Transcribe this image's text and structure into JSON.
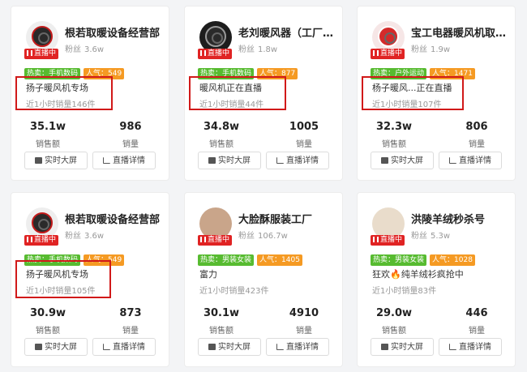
{
  "cards": [
    {
      "name": "根若取暖设备经营部",
      "fans_label": "粉丝",
      "fans": "3.6w",
      "live": "直播中",
      "hot": "热卖：手机数码",
      "pop": "人气：549",
      "line1": "扬子暖风机专场",
      "line2": "近1小时销量146件",
      "sales_amount": "35.1w",
      "sales_amount_label": "销售额",
      "sales": "986",
      "sales_label": "销量",
      "btn1": "实时大屏",
      "btn2": "直播详情"
    },
    {
      "name": "老刘暖风器（工厂直...",
      "fans_label": "粉丝",
      "fans": "1.8w",
      "live": "直播中",
      "hot": "热卖：手机数码",
      "pop": "人气：877",
      "line1": "暖风机正在直播",
      "line2": "近1小时销量44件",
      "sales_amount": "34.8w",
      "sales_amount_label": "销售额",
      "sales": "1005",
      "sales_label": "销量",
      "btn1": "实时大屏",
      "btn2": "直播详情"
    },
    {
      "name": "宝工电器暖风机取暖...",
      "fans_label": "粉丝",
      "fans": "1.9w",
      "live": "直播中",
      "hot": "热卖：户外运动",
      "pop": "人气：1471",
      "line1": "杨子暖风...正在直播",
      "line2": "近1小时销量107件",
      "sales_amount": "32.3w",
      "sales_amount_label": "销售额",
      "sales": "806",
      "sales_label": "销量",
      "btn1": "实时大屏",
      "btn2": "直播详情"
    },
    {
      "name": "根若取暖设备经营部",
      "fans_label": "粉丝",
      "fans": "3.6w",
      "live": "直播中",
      "hot": "热卖：手机数码",
      "pop": "人气：549",
      "line1": "扬子暖风机专场",
      "line2": "近1小时销量105件",
      "sales_amount": "30.9w",
      "sales_amount_label": "销售额",
      "sales": "873",
      "sales_label": "销量",
      "btn1": "实时大屏",
      "btn2": "直播详情"
    },
    {
      "name": "大脸酥服装工厂",
      "fans_label": "粉丝",
      "fans": "106.7w",
      "live": "直播中",
      "hot": "热卖：男装女装",
      "pop": "人气：1405",
      "line1": "富力",
      "line2": "近1小时销量423件",
      "sales_amount": "30.1w",
      "sales_amount_label": "销售额",
      "sales": "4910",
      "sales_label": "销量",
      "btn1": "实时大屏",
      "btn2": "直播详情"
    },
    {
      "name": "洪陵羊绒秒杀号",
      "fans_label": "粉丝",
      "fans": "5.3w",
      "live": "直播中",
      "hot": "热卖：男装女装",
      "pop": "人气：1028",
      "line1": "狂欢🔥纯羊绒衫疯抢中",
      "line2": "近1小时销量83件",
      "sales_amount": "29.0w",
      "sales_amount_label": "销售额",
      "sales": "446",
      "sales_label": "销量",
      "btn1": "实时大屏",
      "btn2": "直播详情"
    }
  ],
  "colors": {
    "live_red": "#e02323",
    "hot_green": "#57bb30",
    "pop_orange": "#f59a23",
    "highlight_red": "#d11919"
  }
}
